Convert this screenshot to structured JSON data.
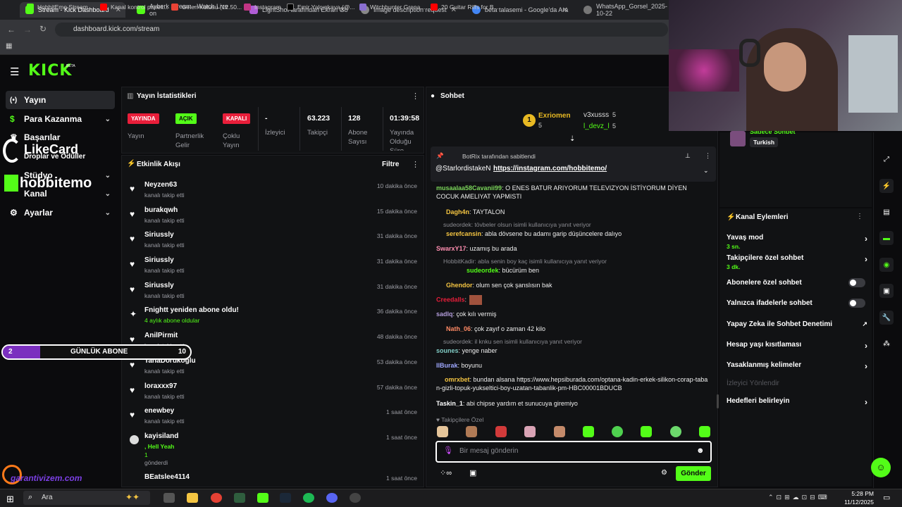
{
  "browser": {
    "tabs": [
      {
        "label": "Stream - Kick Dashboard",
        "active": true
      },
      {
        "label": "Ayberk Stream - Watch Live on",
        "active": false
      },
      {
        "label": "LightShot tarafından Ekran Gö",
        "active": false
      },
      {
        "label": "Image description request",
        "active": false
      },
      {
        "label": "beta talasemi - Google'da Ara",
        "active": false
      },
      {
        "label": "WhatsApp_Gorsel_2025-10-22",
        "active": false
      }
    ],
    "url": "dashboard.kick.com/stream",
    "bookmarks": [
      "HobbitEmo Stream...",
      "Kanal kontrol paneli...",
      "Gelen Kutusu (12.50...",
      "Instagram",
      "Emir Yalçınkaya (@...",
      "Witchhunter Grena...",
      "20 Guitar Riffs for B..."
    ]
  },
  "kick": {
    "logo": "KICK",
    "beta": "BETA"
  },
  "sidebar": {
    "items": [
      {
        "label": "Yayın",
        "icon": "broadcast-icon"
      },
      {
        "label": "Para Kazanma",
        "icon": "dollar-icon"
      },
      {
        "label": "Başarılar",
        "icon": "trophy-icon"
      },
      {
        "label": "Droplar ve Ödüller",
        "icon": "gift-icon"
      },
      {
        "label": "Stüdyo",
        "icon": "studio-icon"
      },
      {
        "label": "Kanal",
        "icon": "channel-icon"
      },
      {
        "label": "Ayarlar",
        "icon": "gear-icon"
      }
    ]
  },
  "overlay": {
    "likecard": "LikeCard",
    "hobbitemo": "hobbitemo",
    "goal_count": "2",
    "goal_label": "GÜNLÜK ABONE",
    "goal_target": "10",
    "garanti": "garantivizem.com"
  },
  "stats": {
    "title": "Yayın İstatistikleri",
    "items": [
      {
        "badge": "YAYINDA",
        "label": "Yayın",
        "badgeColor": "#e91e3a"
      },
      {
        "badge": "AÇIK",
        "label": "Partnerlik Gelir",
        "badgeColor": "#53fc18"
      },
      {
        "badge": "KAPALI",
        "label": "Çoklu Yayın",
        "badgeColor": "#e91e3a"
      },
      {
        "value": "-",
        "label": "İzleyici"
      },
      {
        "value": "63.223",
        "label": "Takipçi"
      },
      {
        "value": "128",
        "label": "Abone Sayısı"
      },
      {
        "value": "01:39:58",
        "label": "Yayında Olduğu Süre"
      }
    ]
  },
  "activity": {
    "title": "Etkinlik Akışı",
    "filter": "Filtre",
    "items": [
      {
        "name": "Neyzen63",
        "sub": "kanalı takip etti",
        "time": "10 dakika önce"
      },
      {
        "name": "burakqwh",
        "sub": "kanalı takip etti",
        "time": "15 dakika önce"
      },
      {
        "name": "Siriussly",
        "sub": "kanalı takip etti",
        "time": "31 dakika önce"
      },
      {
        "name": "Siriussly",
        "sub": "kanalı takip etti",
        "time": "31 dakika önce"
      },
      {
        "name": "Siriussly",
        "sub": "kanalı takip etti",
        "time": "31 dakika önce"
      },
      {
        "name": "Fnightt yeniden abone oldu!",
        "sub": "4 aylık abone oldular",
        "time": "36 dakika önce"
      },
      {
        "name": "AnilPirmit",
        "sub": "kanalı takip etti",
        "time": "48 dakika önce"
      },
      {
        "name": "TahaDorukoglu",
        "sub": "kanalı takip etti",
        "time": "53 dakika önce"
      },
      {
        "name": "loraxxx97",
        "sub": "kanalı takip etti",
        "time": "57 dakika önce"
      },
      {
        "name": "enewbey",
        "sub": "kanalı takip etti",
        "time": "1 saat önce"
      },
      {
        "name": "kayisiland",
        "sub": ", Hell Yeah",
        "time": "1 saat önce"
      },
      {
        "name": "BEatslee4114",
        "sub": "",
        "time": "1 saat önce"
      }
    ],
    "gift_count": "1",
    "gift_sent": "gönderdi"
  },
  "chat": {
    "title": "Sohbet",
    "leaders": [
      {
        "rank": "1",
        "name": "Exriomen",
        "count": "5"
      },
      {
        "rank": "",
        "name": "v3xusss",
        "count": "5"
      },
      {
        "rank": "",
        "name": "l_devz_l",
        "count": "5"
      }
    ],
    "pinned_by": "BotRix tarafından sabitlendi",
    "pinned_user": "@StarlordistakeN",
    "pinned_link": "https://instagram.com/hobbitemo/",
    "messages": [
      {
        "user": "musaalaa58Cavanii99",
        "color": "#7bd55a",
        "text": ": O ENES BATUR ARIYORUM TELEVIZYON İSTİYORUM DİYEN COCUK AMELIYAT YAPMISTI"
      },
      {
        "user": "Dagh4n",
        "color": "#f5c542",
        "text": ": TAYTALON"
      },
      {
        "reply": "sudeordek: tövbeler olsun isimli kullanıcıya yanıt veriyor"
      },
      {
        "user": "serefcansin",
        "color": "#f5c542",
        "text": ": abla dövsene bu adamı garip düşüncelere dalıyo"
      },
      {
        "user": "SwarxY17",
        "color": "#ff8fb1",
        "text": ": uzamış bu arada"
      },
      {
        "reply": "HobbitKadir: abla senin boy kaç isimli kullanıcıya yanıt veriyor"
      },
      {
        "user": "sudeordek",
        "color": "#53fc18",
        "text": ": bücürüm ben"
      },
      {
        "user": "Ghendor",
        "color": "#f5c542",
        "text": ": olum sen çok şanslısın bak"
      },
      {
        "user": "Creedalls",
        "color": "#e91e3a",
        "text": ":"
      },
      {
        "user": "sadlq",
        "color": "#b39ddb",
        "text": ": çok kılı vermiş"
      },
      {
        "user": "Nath_06",
        "color": "#ff8a65",
        "text": ": çok zayıf o zaman 42 kilo"
      },
      {
        "reply": "sudeordek: il knku sen isimli kullanıcıya yanıt veriyor"
      },
      {
        "user": "sounes",
        "color": "#80cbc4",
        "text": ": yenge naber"
      },
      {
        "user": "IlBurak",
        "color": "#9fa8ff",
        "text": ": boyunu"
      },
      {
        "user": "omrxbet",
        "color": "#f5c542",
        "text": ": bundan alsana https://www.hepsiburada.com/optana-kadin-erkek-silikon-corap-taban-gizli-topuk-yukseltici-boy-uzatan-tabanlik-pm-HBC00001BDUCB"
      },
      {
        "user": "Taskin_1",
        "color": "#ffffff",
        "text": ": abi chipse yardım et sunucuya giremiyo"
      }
    ],
    "followers_only": "Takipçilere Özel",
    "input_placeholder": "Bir mesaj gönderin",
    "send": "Gönder"
  },
  "channel": {
    "lang_tag": "Turkish",
    "sub_only_label": "Sadece Sohbet",
    "actions_title": "Kanal Eylemleri",
    "actions": [
      {
        "label": "Yavaş mod",
        "sub": "3 sn.",
        "type": "arrow"
      },
      {
        "label": "Takipçilere özel sohbet",
        "sub": "3 dk.",
        "type": "arrow"
      },
      {
        "label": "Abonelere özel sohbet",
        "sub": "",
        "type": "toggle"
      },
      {
        "label": "Yalnızca ifadelerle sohbet",
        "sub": "",
        "type": "toggle"
      },
      {
        "label": "Yapay Zeka ile Sohbet Denetimi",
        "sub": "",
        "type": "ext"
      },
      {
        "label": "Hesap yaşı kısıtlaması",
        "sub": "",
        "type": "arrow"
      },
      {
        "label": "Yasaklanmış kelimeler",
        "sub": "",
        "type": "arrow"
      },
      {
        "label": "İzleyici Yönlendir",
        "sub": "",
        "type": "none"
      },
      {
        "label": "Hedefleri belirleyin",
        "sub": "",
        "type": "arrow"
      }
    ]
  },
  "taskbar": {
    "search": "Ara",
    "time": "5:28 PM",
    "date": "11/12/2025"
  }
}
